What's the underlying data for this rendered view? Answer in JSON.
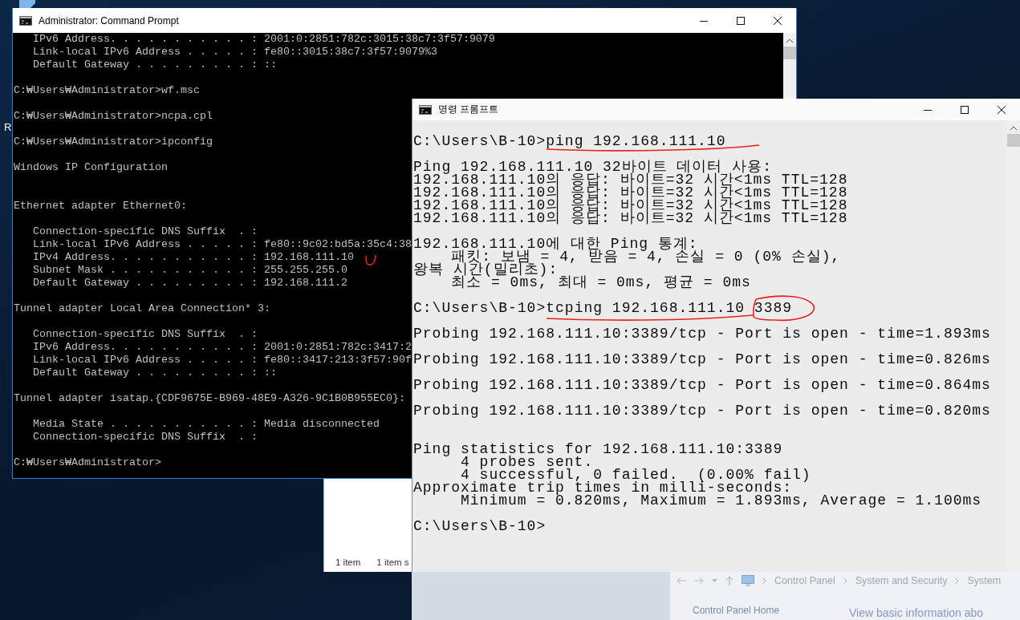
{
  "desktop": {
    "icon_label": "R"
  },
  "admin_console": {
    "title": "Administrator: Command Prompt",
    "blocks": [
      {
        "kind": "plain",
        "lines": [
          {
            "kind": "indent3",
            "text": "IPv6 Address. . . . . . . . . . . : 2001:0:2851:782c:3015:38c7:3f57:9079"
          },
          {
            "kind": "indent3",
            "text": "Link-local IPv6 Address . . . . . : fe80::3015:38c7:3f57:9079%3"
          },
          {
            "kind": "indent3",
            "text": "Default Gateway . . . . . . . . . : ::"
          }
        ]
      },
      {
        "kind": "plain",
        "lines": [
          {
            "kind": "flush",
            "text": "C:₩Users₩Administrator>wf.msc"
          }
        ]
      },
      {
        "kind": "plain",
        "lines": [
          {
            "kind": "flush",
            "text": "C:₩Users₩Administrator>ncpa.cpl"
          }
        ]
      },
      {
        "kind": "plain",
        "lines": [
          {
            "kind": "flush",
            "text": "C:₩Users₩Administrator>ipconfig"
          }
        ]
      },
      {
        "kind": "section",
        "lines": [
          {
            "kind": "flush",
            "text": "Windows IP Configuration"
          }
        ]
      },
      {
        "kind": "plain",
        "lines": [
          {
            "kind": "flush",
            "text": "Ethernet adapter Ethernet0:"
          }
        ]
      },
      {
        "kind": "plain",
        "lines": [
          {
            "kind": "indent3",
            "text": "Connection-specific DNS Suffix  . :"
          },
          {
            "kind": "indent3",
            "text": "Link-local IPv6 Address . . . . . : fe80::9c02:bd5a:35c4:38"
          },
          {
            "kind": "indent3",
            "text": "IPv4 Address. . . . . . . . . . . : 192.168.111.10"
          },
          {
            "kind": "indent3",
            "text": "Subnet Mask . . . . . . . . . . . : 255.255.255.0"
          },
          {
            "kind": "indent3",
            "text": "Default Gateway . . . . . . . . . : 192.168.111.2"
          }
        ]
      },
      {
        "kind": "plain",
        "lines": [
          {
            "kind": "flush",
            "text": "Tunnel adapter Local Area Connection* 3:"
          }
        ]
      },
      {
        "kind": "plain",
        "lines": [
          {
            "kind": "indent3",
            "text": "Connection-specific DNS Suffix  . :"
          },
          {
            "kind": "indent3",
            "text": "IPv6 Address. . . . . . . . . . . : 2001:0:2851:782c:3417:2"
          },
          {
            "kind": "indent3",
            "text": "Link-local IPv6 Address . . . . . : fe80::3417:213:3f57:90f"
          },
          {
            "kind": "indent3",
            "text": "Default Gateway . . . . . . . . . : ::"
          }
        ]
      },
      {
        "kind": "plain",
        "lines": [
          {
            "kind": "flush",
            "text": "Tunnel adapter isatap.{CDF9675E-B969-48E9-A326-9C1B0B955EC0}:"
          }
        ]
      },
      {
        "kind": "plain",
        "lines": [
          {
            "kind": "indent3",
            "text": "Media State . . . . . . . . . . . : Media disconnected"
          },
          {
            "kind": "indent3",
            "text": "Connection-specific DNS Suffix  . :"
          }
        ]
      },
      {
        "kind": "plain",
        "lines": [
          {
            "kind": "flush",
            "text": "C:₩Users₩Administrator>"
          }
        ]
      }
    ]
  },
  "network_window": {
    "status_items": [
      "1 item",
      "1 item s"
    ]
  },
  "korean_console": {
    "title": "명령 프롬프트",
    "blocks": [
      {
        "kind": "plain",
        "lines": [
          {
            "kind": "flush",
            "text": "C:\\Users\\B-10>ping 192.168.111.10"
          }
        ]
      },
      {
        "kind": "plain",
        "lines": [
          {
            "kind": "flush",
            "text": "Ping 192.168.111.10 32바이트 데이터 사용:"
          },
          {
            "kind": "flush",
            "text": "192.168.111.10의 응답: 바이트=32 시간<1ms TTL=128"
          },
          {
            "kind": "flush",
            "text": "192.168.111.10의 응답: 바이트=32 시간<1ms TTL=128"
          },
          {
            "kind": "flush",
            "text": "192.168.111.10의 응답: 바이트=32 시간<1ms TTL=128"
          },
          {
            "kind": "flush",
            "text": "192.168.111.10의 응답: 바이트=32 시간<1ms TTL=128"
          }
        ]
      },
      {
        "kind": "plain",
        "lines": [
          {
            "kind": "flush",
            "text": "192.168.111.10에 대한 Ping 통계:"
          },
          {
            "kind": "indent4",
            "text": "패킷: 보냄 = 4, 받음 = 4, 손실 = 0 (0% 손실),"
          },
          {
            "kind": "flush",
            "text": "왕복 시간(밀리초):"
          },
          {
            "kind": "indent4",
            "text": "최소 = 0ms, 최대 = 0ms, 평균 = 0ms"
          }
        ]
      },
      {
        "kind": "plain",
        "lines": [
          {
            "kind": "flush",
            "text": "C:\\Users\\B-10>tcping 192.168.111.10 3389"
          }
        ]
      },
      {
        "kind": "spaced",
        "lines": [
          {
            "kind": "flush",
            "text": "Probing 192.168.111.10:3389/tcp - Port is open - time=1.893ms"
          },
          {
            "kind": "flush",
            "text": "Probing 192.168.111.10:3389/tcp - Port is open - time=0.826ms"
          },
          {
            "kind": "flush",
            "text": "Probing 192.168.111.10:3389/tcp - Port is open - time=0.864ms"
          },
          {
            "kind": "flush",
            "text": "Probing 192.168.111.10:3389/tcp - Port is open - time=0.820ms"
          }
        ]
      },
      {
        "kind": "plain",
        "lines": [
          {
            "kind": "flush",
            "text": "Ping statistics for 192.168.111.10:3389"
          },
          {
            "kind": "indent5",
            "text": "4 probes sent."
          },
          {
            "kind": "indent5",
            "text": "4 successful, 0 failed.  (0.00% fail)"
          },
          {
            "kind": "flush",
            "text": "Approximate trip times in milli-seconds:"
          },
          {
            "kind": "indent5",
            "text": "Minimum = 0.820ms, Maximum = 1.893ms, Average = 1.100ms"
          }
        ]
      },
      {
        "kind": "plain",
        "lines": [
          {
            "kind": "flush",
            "text": "C:\\Users\\B-10>"
          }
        ]
      }
    ]
  },
  "system_window": {
    "breadcrumb": [
      "Control Panel",
      "System and Security",
      "System"
    ],
    "sidebar_link": "Control Panel Home",
    "heading": "View basic information abo"
  }
}
